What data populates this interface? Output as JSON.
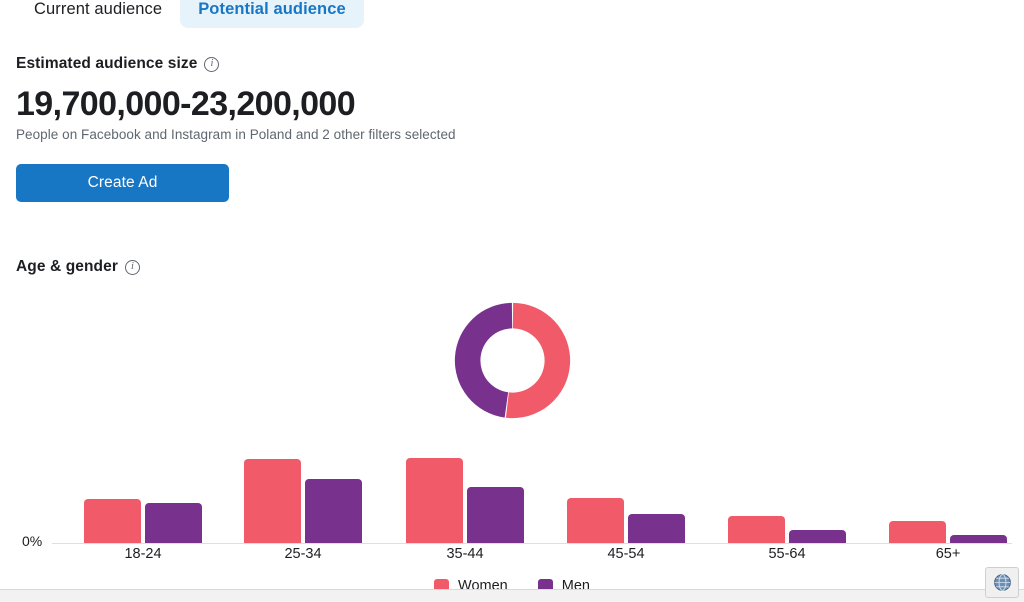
{
  "tabs": [
    {
      "label": "Current audience",
      "active": false
    },
    {
      "label": "Potential audience",
      "active": true
    }
  ],
  "audience": {
    "heading": "Estimated audience size",
    "info_icon": "info-icon",
    "value": "19,700,000-23,200,000",
    "note": "People on Facebook and Instagram in Poland and 2 other filters selected",
    "cta_label": "Create Ad"
  },
  "age_gender": {
    "heading": "Age & gender",
    "info_icon": "info-icon"
  },
  "legend": [
    {
      "label": "Women",
      "color": "#f15b69"
    },
    {
      "label": "Men",
      "color": "#78318c"
    }
  ],
  "browser": {
    "globe_icon": "globe-icon"
  },
  "colors": {
    "women": "#f15b69",
    "men": "#78318c",
    "accent_blue": "#1877c5",
    "tab_active_bg": "#e7f3fb"
  },
  "chart_data": [
    {
      "type": "pie",
      "title": "Age & gender",
      "subtype": "donut",
      "labels": [
        "Women",
        "Men"
      ],
      "values": [
        52,
        48
      ],
      "colors": [
        "#f15b69",
        "#78318c"
      ],
      "legend": "bottom",
      "start_angle_deg": 0
    },
    {
      "type": "bar",
      "title": "",
      "xlabel": "",
      "ylabel": "",
      "categories": [
        "18-24",
        "25-34",
        "35-44",
        "45-54",
        "55-64",
        "65+"
      ],
      "series": [
        {
          "name": "Women",
          "color": "#f15b69",
          "values": [
            7.2,
            13.8,
            14.0,
            7.5,
            4.5,
            3.6
          ]
        },
        {
          "name": "Men",
          "color": "#78318c",
          "values": [
            6.6,
            10.6,
            9.3,
            4.8,
            2.2,
            1.4
          ]
        }
      ],
      "ytick_labels": [
        "0%"
      ],
      "ylim": [
        0,
        15.5
      ],
      "grid": false,
      "legend": "bottom"
    }
  ]
}
